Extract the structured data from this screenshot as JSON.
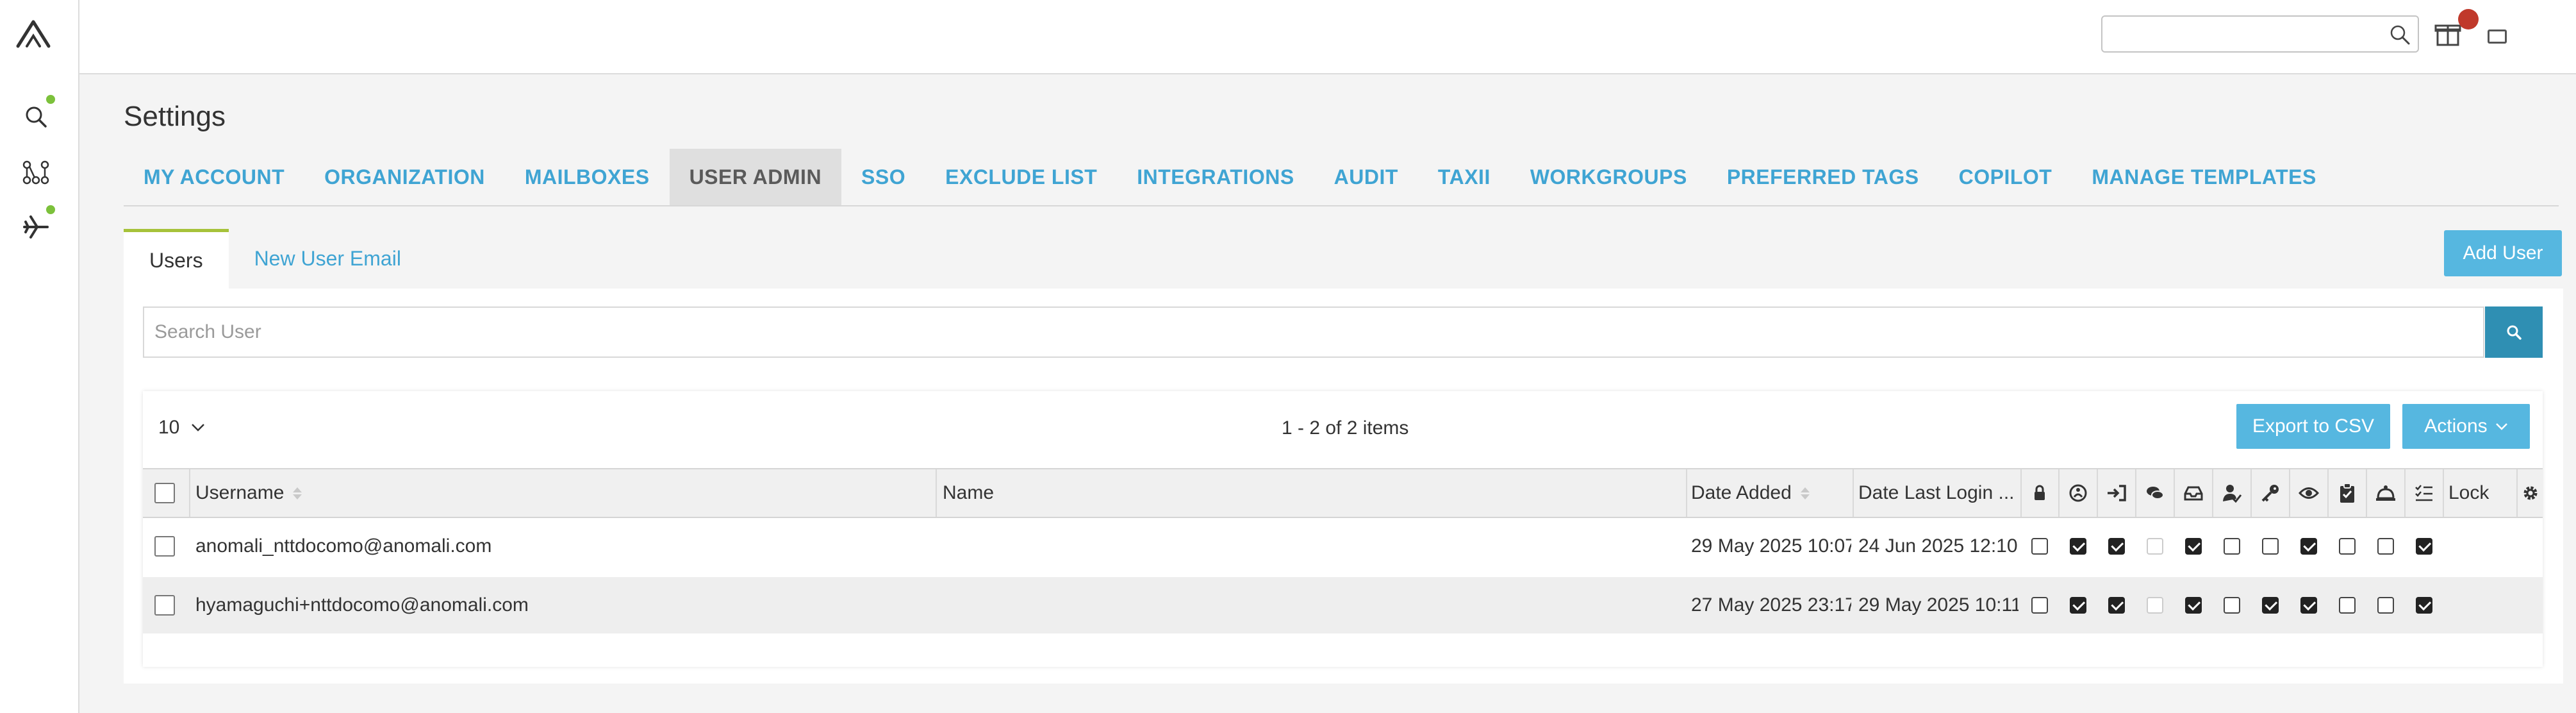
{
  "page": {
    "title": "Settings"
  },
  "nav": [
    "MY ACCOUNT",
    "ORGANIZATION",
    "MAILBOXES",
    "USER ADMIN",
    "SSO",
    "EXCLUDE LIST",
    "INTEGRATIONS",
    "AUDIT",
    "TAXII",
    "WORKGROUPS",
    "PREFERRED TAGS",
    "COPILOT",
    "MANAGE TEMPLATES"
  ],
  "nav_active": "USER ADMIN",
  "subtabs": [
    "Users",
    "New User Email"
  ],
  "add_user_label": "Add User",
  "search_placeholder": "Search User",
  "pager": {
    "page_size": "10",
    "items_text": "1 - 2 of 2 items"
  },
  "buttons": {
    "export": "Export to CSV",
    "actions": "Actions"
  },
  "columns": {
    "username": "Username",
    "name": "Name",
    "date_added": "Date Added",
    "date_last_login": "Date Last Login ...",
    "lock": "Lock"
  },
  "permission_icons": [
    "lock-icon",
    "globe-icon",
    "sign-in-icon",
    "comments-icon",
    "inbox-icon",
    "user-check-icon",
    "key-icon",
    "eye-icon",
    "clipboard-check-icon",
    "bell-icon",
    "list-check-icon"
  ],
  "rows": [
    {
      "username": "anomali_nttdocomo@anomali.com",
      "name": "",
      "date_added": "29 May 2025 10:07",
      "date_last_login": "24 Jun 2025 12:10",
      "perms": [
        "off",
        "on",
        "on",
        "disabled",
        "on",
        "off",
        "off",
        "on",
        "off",
        "off",
        "on"
      ]
    },
    {
      "username": "hyamaguchi+nttdocomo@anomali.com",
      "name": "",
      "date_added": "27 May 2025 23:17",
      "date_last_login": "29 May 2025 10:11",
      "perms": [
        "off",
        "on",
        "on",
        "disabled",
        "on",
        "off",
        "on",
        "on",
        "off",
        "off",
        "on"
      ]
    }
  ],
  "colors": {
    "accent": "#56b7e0",
    "nav_link": "#3fa4d3",
    "active_tab_bar": "#a6c23a",
    "status_green": "#7cc13b",
    "notification_red": "#c0392b"
  }
}
